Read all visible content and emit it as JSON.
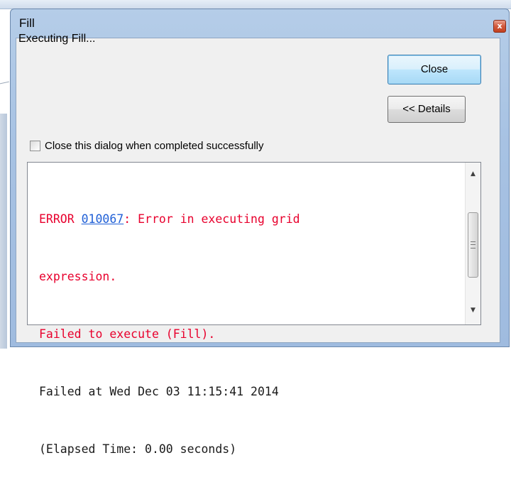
{
  "window": {
    "title": "Fill",
    "close_glyph": "x"
  },
  "status": {
    "text": "Executing Fill..."
  },
  "buttons": {
    "close_label": "Close",
    "details_label": "<< Details"
  },
  "checkbox": {
    "label": "Close this dialog when completed successfully",
    "checked": false
  },
  "messages": {
    "error_prefix": "ERROR ",
    "error_code": "010067",
    "error_suffix": ": Error in executing grid",
    "error_line2": "expression.",
    "failed_execute": "Failed to execute (Fill).",
    "failed_at": "Failed at Wed Dec 03 11:15:41 2014",
    "elapsed": "(Elapsed Time: 0.00 seconds)"
  },
  "colors": {
    "error_text": "#e8002d",
    "link_text": "#1f5fd6",
    "normal_text": "#1a1a1a"
  },
  "icons": {
    "scroll_up": "scroll-up-arrow-icon",
    "scroll_down": "scroll-down-arrow-icon",
    "close": "close-icon"
  }
}
